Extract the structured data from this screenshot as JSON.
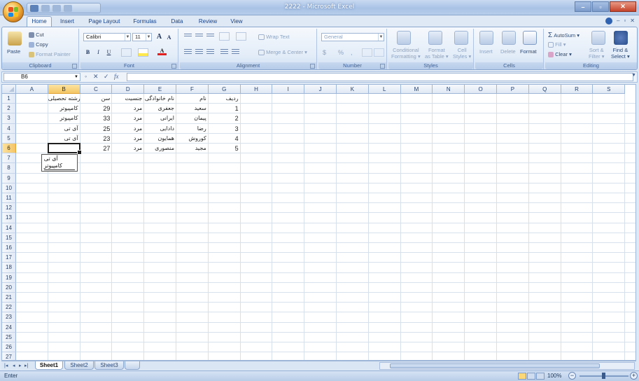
{
  "window": {
    "title": "2222 - Microsoft Excel",
    "controls": [
      "–",
      "▫",
      "✕"
    ]
  },
  "ribbon_tabs": [
    "Home",
    "Insert",
    "Page Layout",
    "Formulas",
    "Data",
    "Review",
    "View"
  ],
  "clipboard": {
    "paste": "Paste",
    "cut": "Cut",
    "copy": "Copy",
    "format_painter": "Format Painter",
    "label": "Clipboard"
  },
  "font": {
    "name": "Calibri",
    "size": "11",
    "grow": "A",
    "shrink": "A",
    "bold": "B",
    "italic": "I",
    "underline": "U",
    "label": "Font"
  },
  "alignment": {
    "wrap_text": "Wrap Text",
    "merge_center": "Merge & Center",
    "label": "Alignment"
  },
  "number": {
    "format": "General",
    "currency": "$",
    "percent": "%",
    "comma": ",",
    "label": "Number"
  },
  "styles": {
    "conditional": "Conditional",
    "conditional2": "Formatting",
    "format_table": "Format",
    "format_table2": "as Table",
    "cell_styles": "Cell",
    "cell_styles2": "Styles",
    "label": "Styles"
  },
  "cells_group": {
    "insert": "Insert",
    "delete": "Delete",
    "format": "Format",
    "label": "Cells"
  },
  "editing": {
    "autosum": "AutoSum",
    "fill": "Fill",
    "clear": "Clear",
    "sort": "Sort &",
    "sort2": "Filter",
    "find": "Find &",
    "find2": "Select",
    "label": "Editing"
  },
  "formula_bar": {
    "name_box": "B6",
    "cancel": "✕",
    "enter": "✓",
    "fx": "fx",
    "value": ""
  },
  "columns": [
    "A",
    "B",
    "C",
    "D",
    "E",
    "F",
    "G",
    "H",
    "I",
    "J",
    "K",
    "L",
    "M",
    "N",
    "O",
    "P",
    "Q",
    "R",
    "S"
  ],
  "selected_column": "B",
  "rows": [
    "1",
    "2",
    "3",
    "4",
    "5",
    "6",
    "7",
    "8",
    "9",
    "10",
    "11",
    "12",
    "13",
    "14",
    "15",
    "16",
    "17",
    "18",
    "19",
    "20",
    "21",
    "22",
    "23",
    "24",
    "25",
    "26",
    "27"
  ],
  "selected_row": "6",
  "table": {
    "headers": {
      "B": "رشته تحصیلی",
      "C": "سن",
      "D": "جنسیت",
      "E": "نام خانوادگی",
      "F": "نام",
      "G": "ردیف"
    },
    "rows": [
      {
        "B": "کامپیوتر",
        "C": "29",
        "D": "مرد",
        "E": "جعفری",
        "F": "سعید",
        "G": "1"
      },
      {
        "B": "کامپیوتر",
        "C": "33",
        "D": "مرد",
        "E": "ایرانی",
        "F": "پیمان",
        "G": "2"
      },
      {
        "B": "آی تی",
        "C": "25",
        "D": "مرد",
        "E": "دادایی",
        "F": "رضا",
        "G": "3"
      },
      {
        "B": "آی تی",
        "C": "23",
        "D": "مرد",
        "E": "همایون",
        "F": "کوروش",
        "G": "4"
      },
      {
        "B": "",
        "C": "27",
        "D": "مرد",
        "E": "منصوری",
        "F": "مجید",
        "G": "5"
      }
    ]
  },
  "autocomplete": [
    "آی تی",
    "کامپیوتر"
  ],
  "sheet_tabs": [
    "Sheet1",
    "Sheet2",
    "Sheet3"
  ],
  "active_sheet": "Sheet1",
  "status": {
    "mode": "Enter",
    "zoom": "100%",
    "minus": "−",
    "plus": "+"
  },
  "colors": {
    "accent": "#15428b",
    "selection": "#f5c563",
    "grid": "#d7e1ee"
  }
}
